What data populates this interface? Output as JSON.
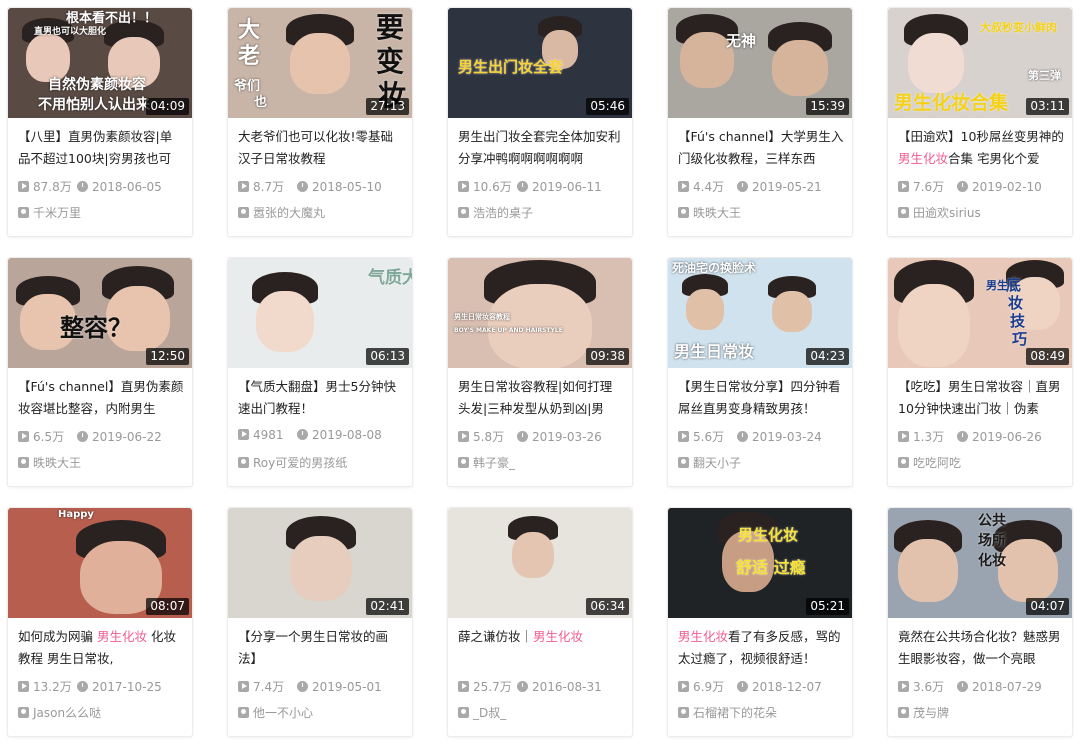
{
  "videos": [
    {
      "thumb": {
        "bg": "#5a4a44",
        "accent": "#e8c8b8",
        "overlays": [
          {
            "text": "根本看不出！！",
            "color": "#ffffff",
            "size": 13
          },
          {
            "text": "直男也可以大胆化",
            "color": "#ffffff",
            "size": 9
          },
          {
            "text": "自然伪素颜妆容",
            "color": "#ffffff",
            "size": 14
          },
          {
            "text": "不用怕别人认出来",
            "color": "#ffffff",
            "size": 14
          }
        ]
      },
      "duration": "04:09",
      "title": [
        {
          "t": "【八里】直男伪素颜妆容|单品不超过100块|穷男孩也可"
        }
      ],
      "views": "87.8万",
      "date": "2018-06-05",
      "author": "千米万里"
    },
    {
      "thumb": {
        "bg": "#c9b5a8",
        "accent": "#e6c3ad",
        "overlays": [
          {
            "text": "大",
            "color": "#ffffff",
            "size": 22
          },
          {
            "text": "老",
            "color": "#ffffff",
            "size": 22
          },
          {
            "text": "爷们",
            "color": "#ffffff",
            "size": 13
          },
          {
            "text": "也",
            "color": "#ffffff",
            "size": 13
          },
          {
            "text": "要",
            "color": "#111111",
            "size": 28
          },
          {
            "text": "变",
            "color": "#111111",
            "size": 28
          },
          {
            "text": "妆",
            "color": "#111111",
            "size": 28
          }
        ]
      },
      "duration": "27:13",
      "title": [
        {
          "t": "大老爷们也可以化妆!零基础汉子日常妆教程"
        }
      ],
      "views": "8.7万",
      "date": "2018-05-10",
      "author": "嚣张的大魔丸"
    },
    {
      "thumb": {
        "bg": "#2e3340",
        "accent": "#d9b9a4",
        "overlays": [
          {
            "text": "男生出门妆全套",
            "color": "#f5d23a",
            "size": 15
          }
        ]
      },
      "duration": "05:46",
      "title": [
        {
          "t": "男生出门妆全套完全体加安利分享冲鸭啊啊啊啊啊啊"
        }
      ],
      "views": "10.6万",
      "date": "2019-06-11",
      "author": "浩浩的桌子"
    },
    {
      "thumb": {
        "bg": "#a9a7a0",
        "accent": "#d6b49c",
        "overlays": [
          {
            "text": "无神",
            "color": "#ffffff",
            "size": 15
          }
        ]
      },
      "duration": "15:39",
      "title": [
        {
          "t": "【Fú's channel】大学男生入门级化妆教程，三样东西"
        }
      ],
      "views": "4.4万",
      "date": "2019-05-21",
      "author": "昳昳大王"
    },
    {
      "thumb": {
        "bg": "#d8d2cf",
        "accent": "#f0dcd2",
        "overlays": [
          {
            "text": "大叔秒变小鲜肉",
            "color": "#f4d21a",
            "size": 11
          },
          {
            "text": "第三弹",
            "color": "#ffffff",
            "size": 11
          },
          {
            "text": "男生化妆合集",
            "color": "#f4d21a",
            "size": 19
          }
        ]
      },
      "duration": "03:11",
      "title": [
        {
          "t": "【田逾欢】10秒屌丝变男神的"
        },
        {
          "t": "男生化妆",
          "hl": true
        },
        {
          "t": "合集 宅男化个爱"
        }
      ],
      "views": "7.6万",
      "date": "2019-02-10",
      "author": "田逾欢sirius"
    },
    {
      "thumb": {
        "bg": "#b9a59a",
        "accent": "#e8c4ae",
        "overlays": [
          {
            "text": "整容？",
            "color": "#111111",
            "size": 24
          }
        ]
      },
      "duration": "12:50",
      "title": [
        {
          "t": "【Fú's channel】直男伪素颜妆容堪比整容，内附男生"
        }
      ],
      "views": "6.5万",
      "date": "2019-06-22",
      "author": "昳昳大王"
    },
    {
      "thumb": {
        "bg": "#e9ecec",
        "accent": "#f1d9cc",
        "overlays": [
          {
            "text": "气质大翻",
            "color": "#7fa89a",
            "size": 17
          }
        ]
      },
      "duration": "06:13",
      "title": [
        {
          "t": "【气质大翻盘】男士5分钟快速出门教程！"
        }
      ],
      "views": "4981",
      "date": "2019-08-08",
      "author": "Roy可爱的男孩纸"
    },
    {
      "thumb": {
        "bg": "#d9bfb2",
        "accent": "#e9cdbd",
        "overlays": [
          {
            "text": "男生日常妆容教程",
            "color": "#ffffff",
            "size": 7
          },
          {
            "text": "BOY'S MAKE UP AND HAIRSTYLE",
            "color": "#ffffff",
            "size": 6
          }
        ]
      },
      "duration": "09:38",
      "title": [
        {
          "t": "男生日常妆容教程|如何打理头发|三种发型从奶到凶|男"
        }
      ],
      "views": "5.8万",
      "date": "2019-03-26",
      "author": "韩子豪_"
    },
    {
      "thumb": {
        "bg": "#cfe2ee",
        "accent": "#e1c0a8",
        "overlays": [
          {
            "text": "死油宅の换脸术",
            "color": "#ffffff",
            "size": 12
          },
          {
            "text": "男生日常妆",
            "color": "#ffffff",
            "size": 16
          }
        ]
      },
      "duration": "04:23",
      "title": [
        {
          "t": "【男生日常妆分享】四分钟看屌丝直男变身精致男孩！"
        }
      ],
      "views": "5.6万",
      "date": "2019-03-24",
      "author": "翻天小子"
    },
    {
      "thumb": {
        "bg": "#e8c9b9",
        "accent": "#efd3c3",
        "overlays": [
          {
            "text": "底",
            "color": "#1b3d8f",
            "size": 15
          },
          {
            "text": "妆",
            "color": "#1b3d8f",
            "size": 15
          },
          {
            "text": "技",
            "color": "#1b3d8f",
            "size": 15
          },
          {
            "text": "巧",
            "color": "#1b3d8f",
            "size": 15
          },
          {
            "text": "男生",
            "color": "#1b3d8f",
            "size": 11
          }
        ]
      },
      "duration": "08:49",
      "title": [
        {
          "t": "【吃吃】男生日常妆容｜直男10分钟快速出门妆｜伪素"
        }
      ],
      "views": "1.3万",
      "date": "2019-06-26",
      "author": "吃吃阿吃"
    },
    {
      "thumb": {
        "bg": "#b75e4f",
        "accent": "#e0b09a",
        "overlays": [
          {
            "text": "Happy",
            "color": "#ffffff",
            "size": 10
          }
        ]
      },
      "duration": "08:07",
      "title": [
        {
          "t": "如何成为网骗 "
        },
        {
          "t": "男生化妆",
          "hl": true
        },
        {
          "t": " 化妆教程 男生日常妆,"
        }
      ],
      "views": "13.2万",
      "date": "2017-10-25",
      "author": "Jason么么哒"
    },
    {
      "thumb": {
        "bg": "#d8d6cf",
        "accent": "#e6cdbd",
        "overlays": []
      },
      "duration": "02:41",
      "title": [
        {
          "t": "【分享一个男生日常妆的画法】"
        }
      ],
      "views": "7.4万",
      "date": "2019-05-01",
      "author": "他一不小心"
    },
    {
      "thumb": {
        "bg": "#e7e3dd",
        "accent": "#e3c5b1",
        "overlays": []
      },
      "duration": "06:34",
      "title": [
        {
          "t": "薛之谦仿妆｜"
        },
        {
          "t": "男生化妆",
          "hl": true
        }
      ],
      "views": "25.7万",
      "date": "2016-08-31",
      "author": "_D叔_"
    },
    {
      "thumb": {
        "bg": "#1f2326",
        "accent": "#c79d83",
        "overlays": [
          {
            "text": "男生化妆",
            "color": "#f5e23a",
            "size": 15
          },
          {
            "text": "舒适 过瘾",
            "color": "#f5e23a",
            "size": 16
          }
        ]
      },
      "duration": "05:21",
      "title": [
        {
          "t": "男生化妆",
          "hl": true
        },
        {
          "t": "看了有多反感，骂的太过瘾了，视频很舒适！"
        }
      ],
      "views": "6.9万",
      "date": "2018-12-07",
      "author": "石榴裙下的花朵"
    },
    {
      "thumb": {
        "bg": "#9aa4b0",
        "accent": "#e3c2ad",
        "overlays": [
          {
            "text": "公共",
            "color": "#1a1a1a",
            "size": 14
          },
          {
            "text": "场所",
            "color": "#1a1a1a",
            "size": 14
          },
          {
            "text": "化妆",
            "color": "#1a1a1a",
            "size": 14
          }
        ]
      },
      "duration": "04:07",
      "title": [
        {
          "t": "竟然在公共场合化妆？魅惑男生眼影妆容，做一个亮眼"
        }
      ],
      "views": "3.6万",
      "date": "2018-07-29",
      "author": "茂与牌"
    }
  ]
}
